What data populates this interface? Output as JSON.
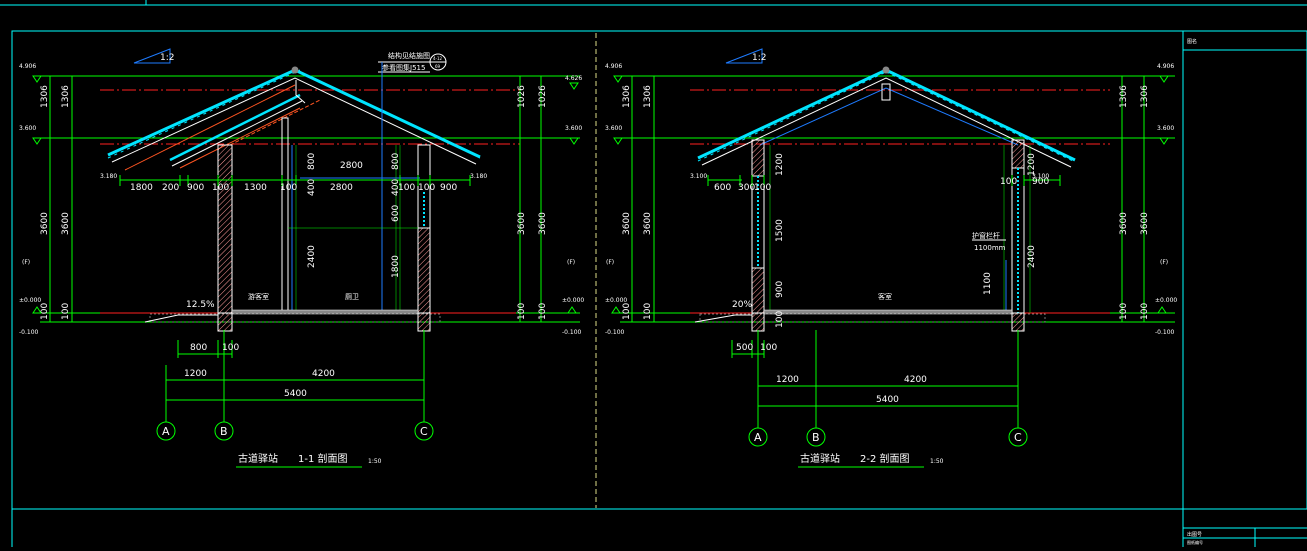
{
  "sheet": {
    "title_block_top": "图名",
    "title_block_bottom": "出图号",
    "title_block_bottom_sub": "图纸编号"
  },
  "left": {
    "title_a": "古道驿站",
    "title_b": "1-1 剖面图",
    "scale": "1:50",
    "slope": "12.5%",
    "rooms": [
      "游客室",
      "厕卫"
    ],
    "ridge_note_1": "结构见结施图",
    "ridge_note_2": "参看图集J515",
    "ridge_bubble_a": "4-12",
    "ridge_bubble_b": "69",
    "elev_left": [
      "4.906",
      "3.600",
      "3.180",
      "±0.000",
      "-0.100"
    ],
    "elev_right": [
      "4.626",
      "3.600",
      "3.180",
      "±0.000",
      "-0.100"
    ],
    "vdims_outer": [
      "1306",
      "3600",
      "100"
    ],
    "vdims_inner": [
      "1306",
      "3600",
      "100"
    ],
    "vdims_right_outer": [
      "1026",
      "3600",
      "100"
    ],
    "vdims_right_inner": [
      "1026",
      "3600",
      "100"
    ],
    "floor_tag_left": "(F)",
    "floor_tag_right": "(F)",
    "top_dims": [
      "1800",
      "200",
      "900",
      "100",
      "1300",
      "100",
      "2800",
      "100",
      "100",
      "900"
    ],
    "span_label": "2800",
    "inner_v": [
      "800",
      "400",
      "2400",
      "800",
      "400",
      "600",
      "1800"
    ],
    "bottom_dims_1": [
      "800",
      "100"
    ],
    "bottom_dims_2": [
      "1200",
      "4200"
    ],
    "bottom_dims_3": [
      "5400"
    ],
    "axes": [
      "A",
      "B",
      "C"
    ]
  },
  "right": {
    "title_a": "古道驿站",
    "title_b": "2-2 剖面图",
    "scale": "1:50",
    "slope": "20%",
    "rooms": [
      "客室"
    ],
    "window_note_1": "护窗栏杆",
    "window_note_2": "1100mm",
    "elev_left": [
      "4.906",
      "3.600",
      "3.100",
      "±0.000",
      "-0.100"
    ],
    "elev_right": [
      "4.906",
      "3.600",
      "3.100",
      "±0.000",
      "-0.100"
    ],
    "vdims_outer": [
      "1306",
      "3600",
      "100"
    ],
    "vdims_inner": [
      "1306",
      "3600",
      "100"
    ],
    "floor_tag_left": "(F)",
    "floor_tag_right": "(F)",
    "top_dims": [
      "600",
      "300",
      "100",
      "100",
      "900"
    ],
    "inner_v": [
      "1200",
      "1500",
      "900",
      "100",
      "1200",
      "2400",
      "1100"
    ],
    "bottom_dims_1": [
      "500",
      "100"
    ],
    "bottom_dims_2": [
      "1200",
      "4200"
    ],
    "bottom_dims_3": [
      "5400"
    ],
    "axes": [
      "A",
      "B",
      "C"
    ]
  },
  "colors": {
    "frame": "#00ffff",
    "dim": "#00ff00",
    "wall": "#ffffff",
    "roof": "#00e5ff",
    "red": "#ff2020",
    "blue": "#1e7bff",
    "bg": "#000000"
  }
}
